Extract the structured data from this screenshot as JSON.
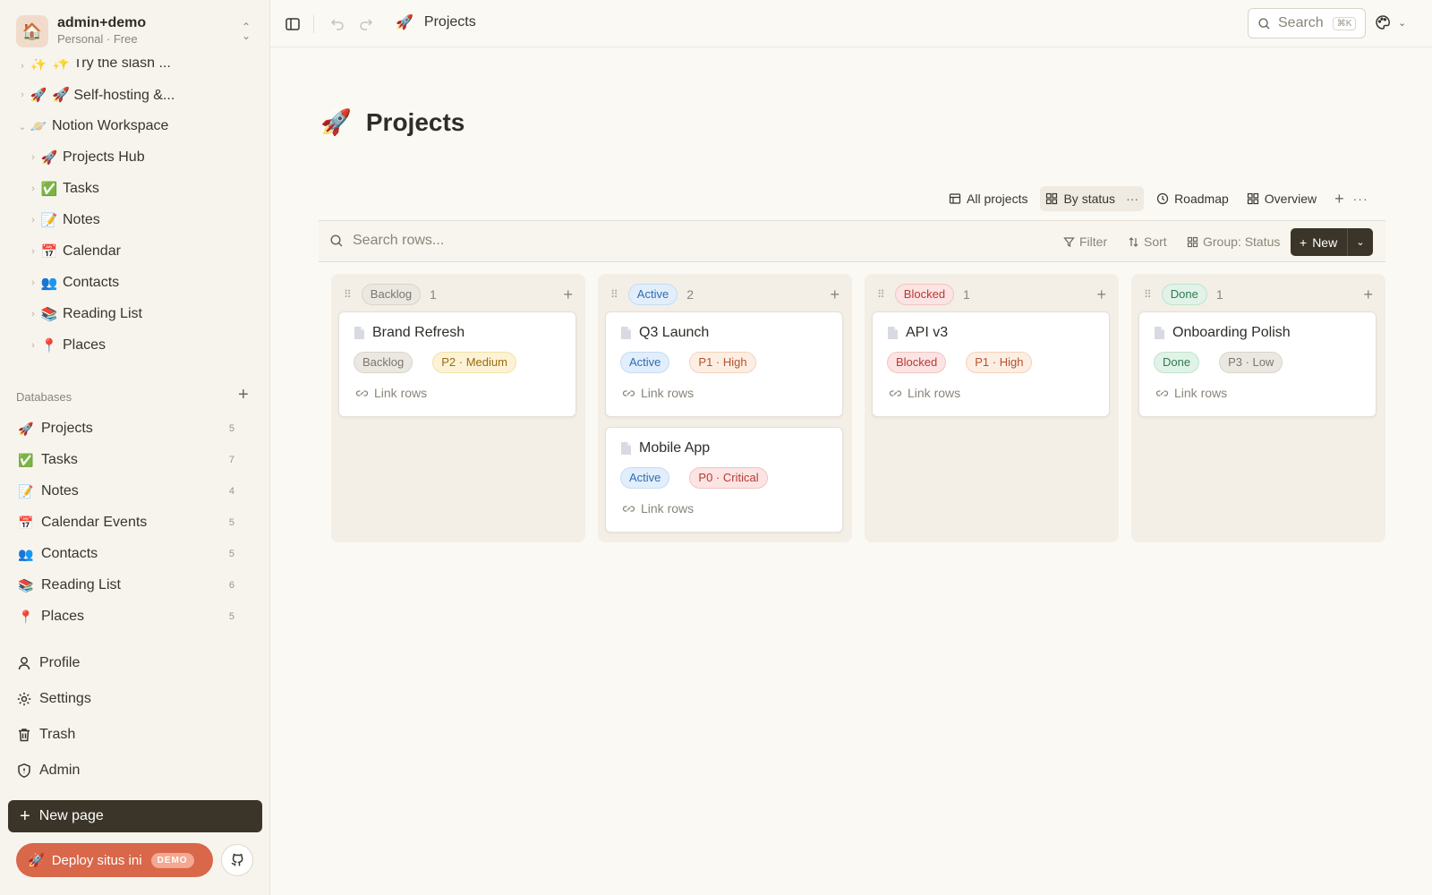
{
  "workspace": {
    "name": "admin+demo",
    "plan": "Personal · Free",
    "avatar": "🏠"
  },
  "sidebar": {
    "tree": [
      {
        "label": "✨ Try the slash ...",
        "emoji": "✨",
        "partial": true
      },
      {
        "label": "🚀 Self-hosting &...",
        "emoji": "🚀"
      },
      {
        "label": "Notion Workspace",
        "emoji": "🪐",
        "expanded": true
      },
      {
        "label": "Projects Hub",
        "emoji": "🚀",
        "child": true
      },
      {
        "label": "Tasks",
        "emoji": "✅",
        "child": true
      },
      {
        "label": "Notes",
        "emoji": "📝",
        "child": true
      },
      {
        "label": "Calendar",
        "emoji": "📅",
        "child": true
      },
      {
        "label": "Contacts",
        "emoji": "👥",
        "child": true
      },
      {
        "label": "Reading List",
        "emoji": "📚",
        "child": true
      },
      {
        "label": "Places",
        "emoji": "📍",
        "child": true
      }
    ],
    "databases_label": "Databases",
    "databases": [
      {
        "label": "Projects",
        "emoji": "🚀",
        "count": "5"
      },
      {
        "label": "Tasks",
        "emoji": "✅",
        "count": "7"
      },
      {
        "label": "Notes",
        "emoji": "📝",
        "count": "4"
      },
      {
        "label": "Calendar Events",
        "emoji": "📅",
        "count": "5"
      },
      {
        "label": "Contacts",
        "emoji": "👥",
        "count": "5"
      },
      {
        "label": "Reading List",
        "emoji": "📚",
        "count": "6"
      },
      {
        "label": "Places",
        "emoji": "📍",
        "count": "5"
      }
    ],
    "utilities": [
      {
        "label": "Profile",
        "icon": "person-icon"
      },
      {
        "label": "Settings",
        "icon": "gear-icon"
      },
      {
        "label": "Trash",
        "icon": "trash-icon"
      },
      {
        "label": "Admin",
        "icon": "shield-icon"
      }
    ],
    "new_page_label": "New page",
    "deploy_label": "Deploy situs ini",
    "demo_badge": "DEMO"
  },
  "topbar": {
    "breadcrumb": "Projects",
    "breadcrumb_emoji": "🚀",
    "search_label": "Search",
    "search_kbd": "⌘K"
  },
  "page": {
    "title": "Projects",
    "emoji": "🚀",
    "views": [
      {
        "label": "All projects",
        "icon": "table-icon"
      },
      {
        "label": "By status",
        "icon": "board-icon",
        "active": true
      },
      {
        "label": "Roadmap",
        "icon": "clock-icon"
      },
      {
        "label": "Overview",
        "icon": "gallery-icon"
      }
    ],
    "search_placeholder": "Search rows...",
    "filter_label": "Filter",
    "sort_label": "Sort",
    "group_label": "Group: Status",
    "new_label": "New"
  },
  "board": {
    "link_label": "Link rows",
    "columns": [
      {
        "status": "Backlog",
        "count": "1",
        "cards": [
          {
            "title": "Brand Refresh",
            "status": "Backlog",
            "priority": "P2 · Medium",
            "pcls": "p2"
          }
        ]
      },
      {
        "status": "Active",
        "count": "2",
        "cards": [
          {
            "title": "Q3 Launch",
            "status": "Active",
            "priority": "P1 · High",
            "pcls": "p1"
          },
          {
            "title": "Mobile App",
            "status": "Active",
            "priority": "P0 · Critical",
            "pcls": "p0"
          }
        ]
      },
      {
        "status": "Blocked",
        "count": "1",
        "cards": [
          {
            "title": "API v3",
            "status": "Blocked",
            "priority": "P1 · High",
            "pcls": "p1"
          }
        ]
      },
      {
        "status": "Done",
        "count": "1",
        "cards": [
          {
            "title": "Onboarding Polish",
            "status": "Done",
            "priority": "P3 · Low",
            "pcls": "p3"
          }
        ]
      }
    ]
  }
}
